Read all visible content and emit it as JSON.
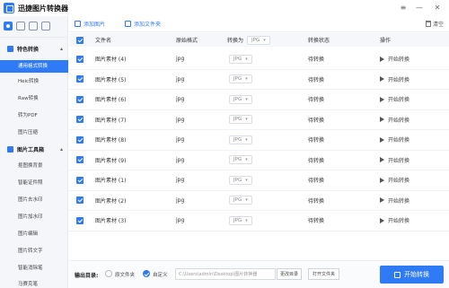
{
  "app": {
    "title": "迅捷图片转换器"
  },
  "window_controls": {
    "menu": "≡",
    "minimize": "—",
    "close": "✕"
  },
  "sidebar": {
    "groups": [
      {
        "label": "特色转换",
        "items": [
          "通用格式转换",
          "Heic转换",
          "Raw转换",
          "转为PDF",
          "图片压缩"
        ]
      },
      {
        "label": "图片工具箱",
        "items": [
          "抠图换背景",
          "智能证件照",
          "图片去水印",
          "图片加水印",
          "图片编辑",
          "图片转文字",
          "智能消除笔",
          "马赛克笔"
        ]
      }
    ],
    "active_item": "通用格式转换"
  },
  "toolbar": {
    "add_image": "添加图片",
    "add_folder": "添加文件夹",
    "clear": "清空"
  },
  "table": {
    "headers": {
      "name": "文件名",
      "format": "原始格式",
      "convert_to": "转换为",
      "status": "转换状态",
      "action": "操作"
    },
    "header_select_value": "JPG",
    "rows": [
      {
        "name": "图片素材 (4)",
        "format": "jpg",
        "target": "JPG",
        "status": "待转换",
        "action": "开始转换"
      },
      {
        "name": "图片素材 (5)",
        "format": "jpg",
        "target": "JPG",
        "status": "待转换",
        "action": "开始转换"
      },
      {
        "name": "图片素材 (6)",
        "format": "jpg",
        "target": "JPG",
        "status": "待转换",
        "action": "开始转换"
      },
      {
        "name": "图片素材 (7)",
        "format": "jpg",
        "target": "JPG",
        "status": "待转换",
        "action": "开始转换"
      },
      {
        "name": "图片素材 (8)",
        "format": "jpg",
        "target": "JPG",
        "status": "待转换",
        "action": "开始转换"
      },
      {
        "name": "图片素材 (9)",
        "format": "jpg",
        "target": "JPG",
        "status": "待转换",
        "action": "开始转换"
      },
      {
        "name": "图片素材 (1)",
        "format": "jpg",
        "target": "JPG",
        "status": "待转换",
        "action": "开始转换"
      },
      {
        "name": "图片素材 (2)",
        "format": "jpg",
        "target": "JPG",
        "status": "待转换",
        "action": "开始转换"
      },
      {
        "name": "图片素材 (3)",
        "format": "jpg",
        "target": "JPG",
        "status": "待转换",
        "action": "开始转换"
      }
    ]
  },
  "footer": {
    "output_label": "输出目录:",
    "option_original": "原文件夹",
    "option_custom": "自定义",
    "path": "C:\\Users\\admin\\Desktop\\图片转换器",
    "change_dir": "更改目录",
    "open_folder": "打开文件夹",
    "start_all": "开始转换"
  },
  "colors": {
    "accent": "#2f7bf6",
    "sidebar_bg": "#f4f6fa",
    "header_bg": "#f5f7fa"
  }
}
